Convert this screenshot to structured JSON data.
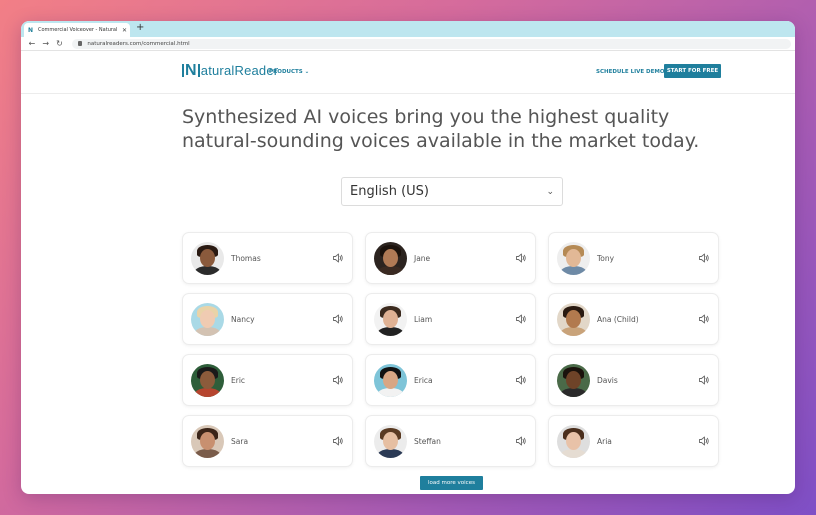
{
  "browser": {
    "tab_title": "Commercial Voiceover - Natural R",
    "tab_favicon": "N",
    "url": "naturalreaders.com/commercial.html"
  },
  "header": {
    "logo_mark": "N",
    "logo_text": "aturalReader",
    "products_label": "PRODUCTS",
    "schedule_label": "SCHEDULE LIVE DEMO",
    "start_label": "START FOR FREE"
  },
  "main": {
    "headline": "Synthesized AI voices bring you the highest quality natural-sounding voices available in the market today.",
    "language": "English (US)",
    "load_more_label": "load more voices"
  },
  "voices": [
    {
      "name": "Thomas",
      "skin": "#8a5a3c",
      "hair": "#2a1a12",
      "bg": "#e9e9e9",
      "shirt": "#2b2b2b"
    },
    {
      "name": "Jane",
      "skin": "#b07a55",
      "hair": "#1b120c",
      "bg": "#2c2420",
      "shirt": "#3a2a22"
    },
    {
      "name": "Tony",
      "skin": "#e2b896",
      "hair": "#b58a55",
      "bg": "#eeeeee",
      "shirt": "#6e8aa6"
    },
    {
      "name": "Nancy",
      "skin": "#f0cbb2",
      "hair": "#e9d3a8",
      "bg": "#a9d9e6",
      "shirt": "#d3c2b2"
    },
    {
      "name": "Liam",
      "skin": "#e0b294",
      "hair": "#3b2a1e",
      "bg": "#f2f2f2",
      "shirt": "#222222"
    },
    {
      "name": "Ana (Child)",
      "skin": "#b27a4e",
      "hair": "#2a1a10",
      "bg": "#e2d7c8",
      "shirt": "#c9a37a"
    },
    {
      "name": "Eric",
      "skin": "#8c5b3b",
      "hair": "#1a1a1a",
      "bg": "#2e5e3a",
      "shirt": "#b6452f"
    },
    {
      "name": "Erica",
      "skin": "#d8a684",
      "hair": "#111111",
      "bg": "#7ec4d8",
      "shirt": "#f2f2f2"
    },
    {
      "name": "Davis",
      "skin": "#6e4328",
      "hair": "#1a120c",
      "bg": "#4a6a48",
      "shirt": "#2a2a2a"
    },
    {
      "name": "Sara",
      "skin": "#c89070",
      "hair": "#3a2418",
      "bg": "#d9c8b8",
      "shirt": "#7a5c4a"
    },
    {
      "name": "Steffan",
      "skin": "#e6bfa2",
      "hair": "#5a3a22",
      "bg": "#ececec",
      "shirt": "#2b3a55"
    },
    {
      "name": "Aria",
      "skin": "#e8c2a8",
      "hair": "#4a2e1c",
      "bg": "#dedede",
      "shirt": "#e5dcd2"
    }
  ],
  "colors": {
    "brand": "#1f7f9d",
    "headline_text": "#555555"
  },
  "icons": {
    "voice_action": "speaker-icon",
    "select": "chevron-down-icon"
  }
}
